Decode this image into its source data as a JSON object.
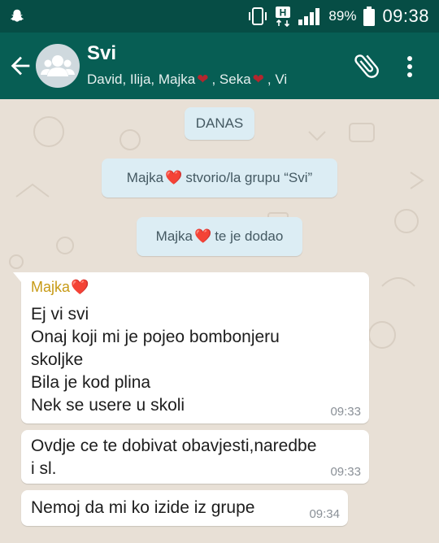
{
  "status_bar": {
    "network_label": "H",
    "battery_percent": "89%",
    "time": "09:38"
  },
  "app_bar": {
    "title": "Svi",
    "members": [
      "David, Ilija, Majka",
      ", Seka",
      ", Vi"
    ],
    "back_icon": "arrow-back-icon",
    "attach_icon": "paperclip-icon",
    "menu_icon": "more-vert-icon",
    "avatar_icon": "group-avatar-icon"
  },
  "chat": {
    "date_chip": "DANAS",
    "system_messages": [
      {
        "actor": "Majka",
        "text": "stvorio/la grupu “Svi”"
      },
      {
        "actor": "Majka",
        "text": "te je dodao"
      }
    ],
    "messages": [
      {
        "sender": "Majka",
        "lines": [
          "Ej vi svi",
          "Onaj koji mi je pojeo bombonjeru",
          "skoljke",
          "Bila je kod plina",
          "Nek se usere u skoli"
        ],
        "time": "09:33"
      },
      {
        "lines": [
          "Ovdje ce te dobivat obavjesti,naredbe",
          "i sl."
        ],
        "time": "09:33"
      },
      {
        "lines": [
          "Nemoj da mi ko izide iz grupe"
        ],
        "time": "09:34"
      }
    ]
  },
  "colors": {
    "header": "#075e54",
    "status_bar": "#064d45",
    "sender_name": "#c79a16",
    "system_bubble": "#dcedf4",
    "heart": "#b3262e"
  }
}
